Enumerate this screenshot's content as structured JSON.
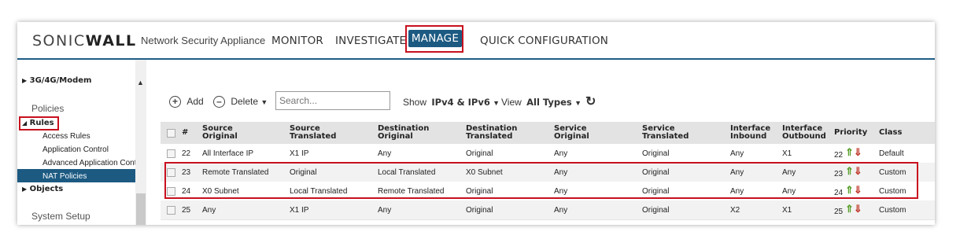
{
  "header": {
    "logo_text_1": "SONIC",
    "logo_text_2": "WALL",
    "product": "Network Security Appliance",
    "nav": [
      "MONITOR",
      "INVESTIGATE",
      "MANAGE",
      "QUICK CONFIGURATION"
    ],
    "active_nav": "MANAGE"
  },
  "sidebar": {
    "modem": "3G/4G/Modem",
    "policies": "Policies",
    "rules": "Rules",
    "rules_children": [
      "Access Rules",
      "Application Control",
      "Advanced Application Control",
      "NAT Policies"
    ],
    "selected": "NAT Policies",
    "objects": "Objects",
    "system_setup": "System Setup"
  },
  "toolbar": {
    "add": "Add",
    "delete": "Delete",
    "search_placeholder": "Search...",
    "show_label": "Show",
    "show_value": "IPv4 & IPv6",
    "view_label": "View",
    "view_value": "All Types"
  },
  "table": {
    "headers": {
      "num": "#",
      "src_orig_1": "Source",
      "src_orig_2": "Original",
      "src_tr_1": "Source",
      "src_tr_2": "Translated",
      "dst_orig_1": "Destination",
      "dst_orig_2": "Original",
      "dst_tr_1": "Destination",
      "dst_tr_2": "Translated",
      "svc_orig_1": "Service",
      "svc_orig_2": "Original",
      "svc_tr_1": "Service",
      "svc_tr_2": "Translated",
      "if_in_1": "Interface",
      "if_in_2": "Inbound",
      "if_out_1": "Interface",
      "if_out_2": "Outbound",
      "priority": "Priority",
      "class": "Class"
    },
    "rows": [
      {
        "num": "22",
        "src_orig": "All Interface IP",
        "src_tr": "X1 IP",
        "dst_orig": "Any",
        "dst_tr": "Original",
        "svc_orig": "Any",
        "svc_tr": "Original",
        "if_in": "Any",
        "if_out": "X1",
        "priority": "22",
        "class": "Default"
      },
      {
        "num": "23",
        "src_orig": "Remote Translated",
        "src_tr": "Original",
        "dst_orig": "Local Translated",
        "dst_tr": "X0 Subnet",
        "svc_orig": "Any",
        "svc_tr": "Original",
        "if_in": "Any",
        "if_out": "Any",
        "priority": "23",
        "class": "Custom"
      },
      {
        "num": "24",
        "src_orig": "X0 Subnet",
        "src_tr": "Local Translated",
        "dst_orig": "Remote Translated",
        "dst_tr": "Original",
        "svc_orig": "Any",
        "svc_tr": "Original",
        "if_in": "Any",
        "if_out": "Any",
        "priority": "24",
        "class": "Custom"
      },
      {
        "num": "25",
        "src_orig": "Any",
        "src_tr": "X1 IP",
        "dst_orig": "Any",
        "dst_tr": "Original",
        "svc_orig": "Any",
        "svc_tr": "Original",
        "if_in": "X2",
        "if_out": "X1",
        "priority": "25",
        "class": "Custom"
      }
    ]
  },
  "colors": {
    "accent": "#1c5a82",
    "highlight": "#c8101e",
    "priority_up": "#5aa02c",
    "priority_down": "#c0392b"
  }
}
